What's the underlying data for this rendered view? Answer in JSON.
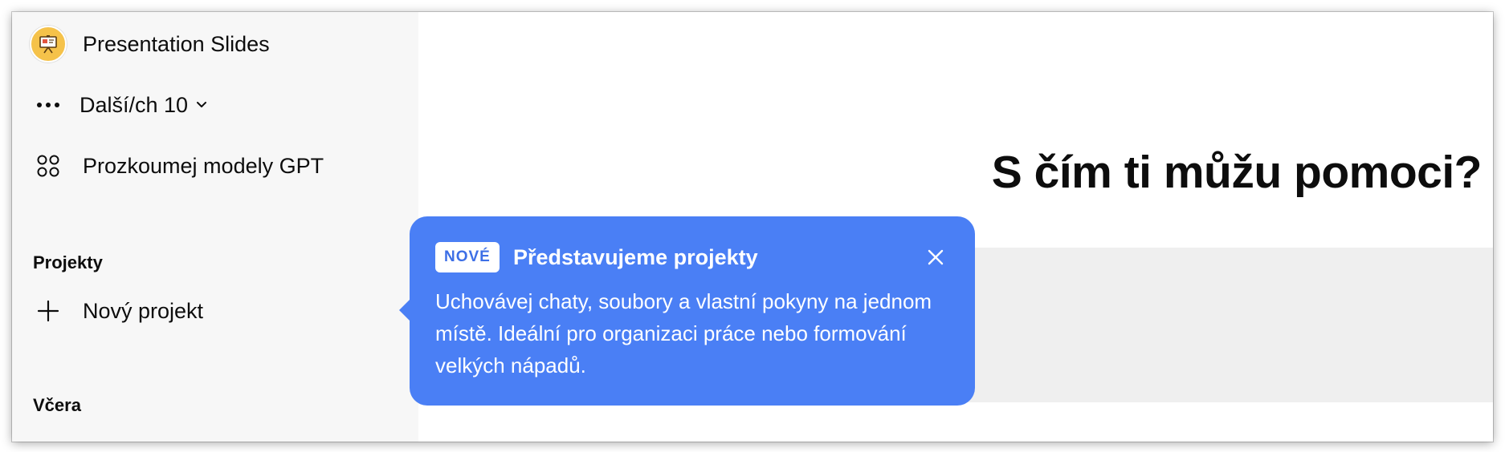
{
  "sidebar": {
    "gpt_item": {
      "label": "Presentation Slides",
      "icon": "presentation-board-icon"
    },
    "more_item": {
      "label": "Další/ch 10",
      "icon": "ellipsis-icon"
    },
    "explore_item": {
      "label": "Prozkoumej modely GPT",
      "icon": "grid-circles-icon"
    },
    "projects_title": "Projekty",
    "new_project": {
      "label": "Nový projekt",
      "icon": "plus-icon"
    },
    "yesterday_title": "Včera"
  },
  "main": {
    "headline": "S čím ti můžu pomoci?"
  },
  "tooltip": {
    "badge": "NOVÉ",
    "title": "Představujeme projekty",
    "body": "Uchovávej chaty, soubory a vlastní pokyny na jednom místě. Ideální pro organizaci práce nebo formování velkých nápadů.",
    "color": "#4a7ff5"
  }
}
